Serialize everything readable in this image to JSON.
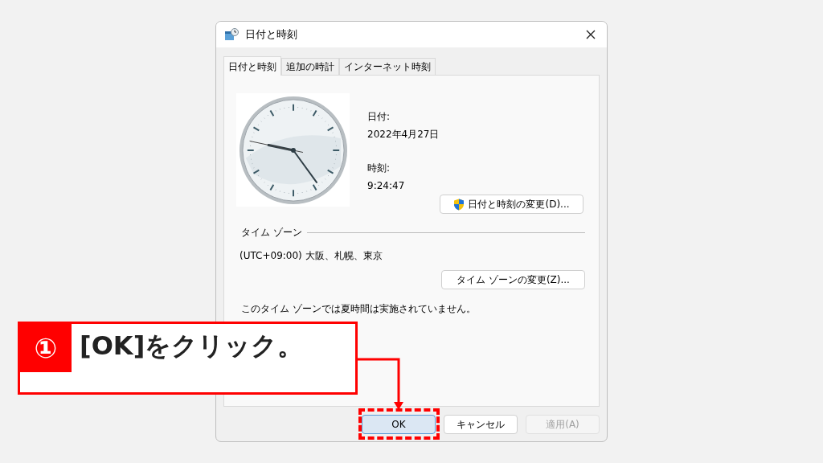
{
  "window": {
    "title": "日付と時刻"
  },
  "tabs": [
    {
      "label": "日付と時刻",
      "selected": true
    },
    {
      "label": "追加の時計",
      "selected": false
    },
    {
      "label": "インターネット時刻",
      "selected": false
    }
  ],
  "date": {
    "label": "日付:",
    "value": "2022年4月27日"
  },
  "time": {
    "label": "時刻:",
    "value": "9:24:47"
  },
  "change_datetime_button": "日付と時刻の変更(D)...",
  "time_zone": {
    "heading": "タイム ゾーン",
    "value": "(UTC+09:00) 大阪、札幌、東京",
    "change_button": "タイム ゾーンの変更(Z)...",
    "dst_note": "このタイム ゾーンでは夏時間は実施されていません。"
  },
  "buttons": [
    {
      "label": "OK",
      "disabled": false,
      "default": true
    },
    {
      "label": "キャンセル",
      "disabled": false,
      "default": false
    },
    {
      "label": "適用(A)",
      "disabled": true,
      "default": false
    }
  ],
  "annotation": {
    "number": "①",
    "text": "[OK]をクリック。"
  }
}
